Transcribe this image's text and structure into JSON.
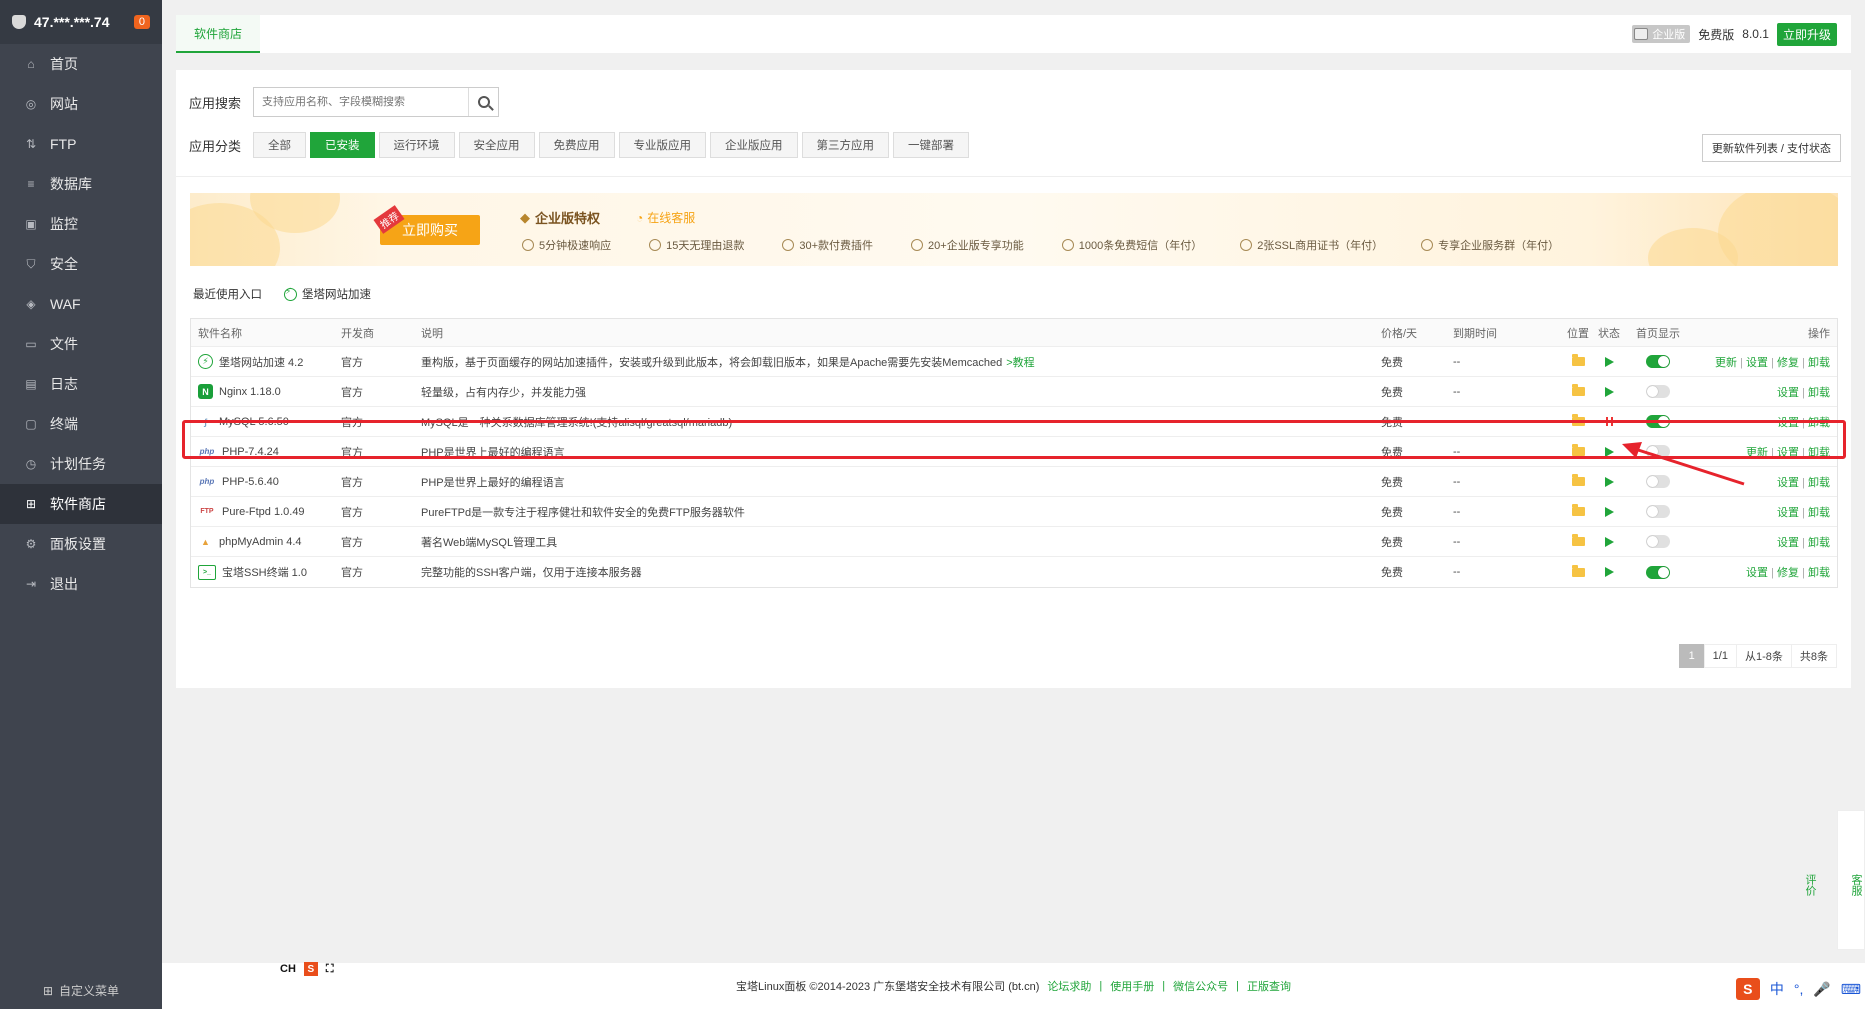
{
  "sidebar": {
    "server_ip": "47.***.***.74",
    "badge": "0",
    "items": [
      {
        "label": "首页",
        "icon": "home-icon"
      },
      {
        "label": "网站",
        "icon": "globe-icon"
      },
      {
        "label": "FTP",
        "icon": "ftp-icon"
      },
      {
        "label": "数据库",
        "icon": "database-icon"
      },
      {
        "label": "监控",
        "icon": "monitor-icon"
      },
      {
        "label": "安全",
        "icon": "shield-icon"
      },
      {
        "label": "WAF",
        "icon": "waf-icon"
      },
      {
        "label": "文件",
        "icon": "folder-icon"
      },
      {
        "label": "日志",
        "icon": "log-icon"
      },
      {
        "label": "终端",
        "icon": "terminal-icon"
      },
      {
        "label": "计划任务",
        "icon": "clock-icon"
      },
      {
        "label": "软件商店",
        "icon": "grid-icon",
        "active": true
      },
      {
        "label": "面板设置",
        "icon": "gear-icon"
      },
      {
        "label": "退出",
        "icon": "logout-icon"
      }
    ],
    "footer_label": "自定义菜单"
  },
  "topbar": {
    "tab": "软件商店",
    "enterprise_tag": "企业版",
    "edition": "免费版",
    "version": "8.0.1",
    "upgrade_label": "立即升级"
  },
  "search": {
    "label": "应用搜索",
    "placeholder": "支持应用名称、字段模糊搜索"
  },
  "category": {
    "label": "应用分类",
    "buttons": [
      "全部",
      "已安装",
      "运行环境",
      "安全应用",
      "免费应用",
      "专业版应用",
      "企业版应用",
      "第三方应用",
      "一键部署"
    ],
    "active_index": 1,
    "refresh_label": "更新软件列表 / 支付状态"
  },
  "banner": {
    "buy_tag": "推荐",
    "buy_label": "立即购买",
    "title": "企业版特权",
    "online_service": "在线客服",
    "perks": [
      "5分钟极速响应",
      "15天无理由退款",
      "30+款付费插件",
      "20+企业版专享功能",
      "1000条免费短信（年付）",
      "2张SSL商用证书（年付）",
      "专享企业服务群（年付）"
    ]
  },
  "recent": {
    "label": "最近使用入口",
    "items": [
      "堡塔网站加速"
    ]
  },
  "table": {
    "headers": [
      "软件名称",
      "开发商",
      "说明",
      "价格/天",
      "到期时间",
      "位置",
      "状态",
      "首页显示",
      "操作"
    ],
    "rows": [
      {
        "name": "堡塔网站加速 4.2",
        "icon": "bolt-icon",
        "dev": "官方",
        "desc": "重构版，基于页面缓存的网站加速插件，安装或升级到此版本，将会卸载旧版本，如果是Apache需要先安装Memcached",
        "desc_link": ">教程",
        "price": "免费",
        "expire": "--",
        "status": "running",
        "home": true,
        "ops": [
          "更新",
          "设置",
          "修复",
          "卸载"
        ]
      },
      {
        "name": "Nginx 1.18.0",
        "icon": "nginx-icon",
        "dev": "官方",
        "desc": "轻量级，占有内存少，并发能力强",
        "desc_link": "",
        "price": "免费",
        "expire": "--",
        "status": "running",
        "home": false,
        "ops": [
          "设置",
          "卸载"
        ]
      },
      {
        "name": "MySQL 5.6.50",
        "icon": "mysql-icon",
        "dev": "官方",
        "desc": "MySQL是一种关系数据库管理系统!(支持alisql/greatsql/mariadb)",
        "desc_link": "",
        "price": "免费",
        "expire": "--",
        "status": "stopped",
        "home": true,
        "ops": [
          "设置",
          "卸载"
        ]
      },
      {
        "name": "PHP-7.4.24",
        "icon": "php-icon",
        "dev": "官方",
        "desc": "PHP是世界上最好的编程语言",
        "desc_link": "",
        "price": "免费",
        "expire": "--",
        "status": "running",
        "home": false,
        "ops": [
          "更新",
          "设置",
          "卸载"
        ]
      },
      {
        "name": "PHP-5.6.40",
        "icon": "php-icon",
        "dev": "官方",
        "desc": "PHP是世界上最好的编程语言",
        "desc_link": "",
        "price": "免费",
        "expire": "--",
        "status": "running",
        "home": false,
        "ops": [
          "设置",
          "卸载"
        ]
      },
      {
        "name": "Pure-Ftpd 1.0.49",
        "icon": "ftpd-icon",
        "dev": "官方",
        "desc": "PureFTPd是一款专注于程序健壮和软件安全的免费FTP服务器软件",
        "desc_link": "",
        "price": "免费",
        "expire": "--",
        "status": "running",
        "home": false,
        "ops": [
          "设置",
          "卸载"
        ]
      },
      {
        "name": "phpMyAdmin 4.4",
        "icon": "phpmyadmin-icon",
        "dev": "官方",
        "desc": "著名Web端MySQL管理工具",
        "desc_link": "",
        "price": "免费",
        "expire": "--",
        "status": "running",
        "home": false,
        "ops": [
          "设置",
          "卸载"
        ]
      },
      {
        "name": "宝塔SSH终端 1.0",
        "icon": "ssh-terminal-icon",
        "dev": "官方",
        "desc": "完整功能的SSH客户端，仅用于连接本服务器",
        "desc_link": "",
        "price": "免费",
        "expire": "--",
        "status": "running",
        "home": true,
        "ops": [
          "设置",
          "修复",
          "卸载"
        ]
      }
    ]
  },
  "pager": {
    "current": "1",
    "pages": "1/1",
    "range": "从1-8条",
    "total": "共8条"
  },
  "footer": {
    "copyright": "宝塔Linux面板 ©2014-2023 广东堡塔安全技术有限公司 (bt.cn)",
    "links": [
      "论坛求助",
      "使用手册",
      "微信公众号",
      "正版查询"
    ]
  },
  "float": {
    "service": "客服",
    "rate": "评价"
  },
  "ime": {
    "top_left": "CH",
    "s_glyph": "S",
    "bottom_right_mode": "中"
  },
  "colors": {
    "accent": "#20a53a",
    "highlight": "#e6232c",
    "sidebar_bg": "#3f444e"
  }
}
